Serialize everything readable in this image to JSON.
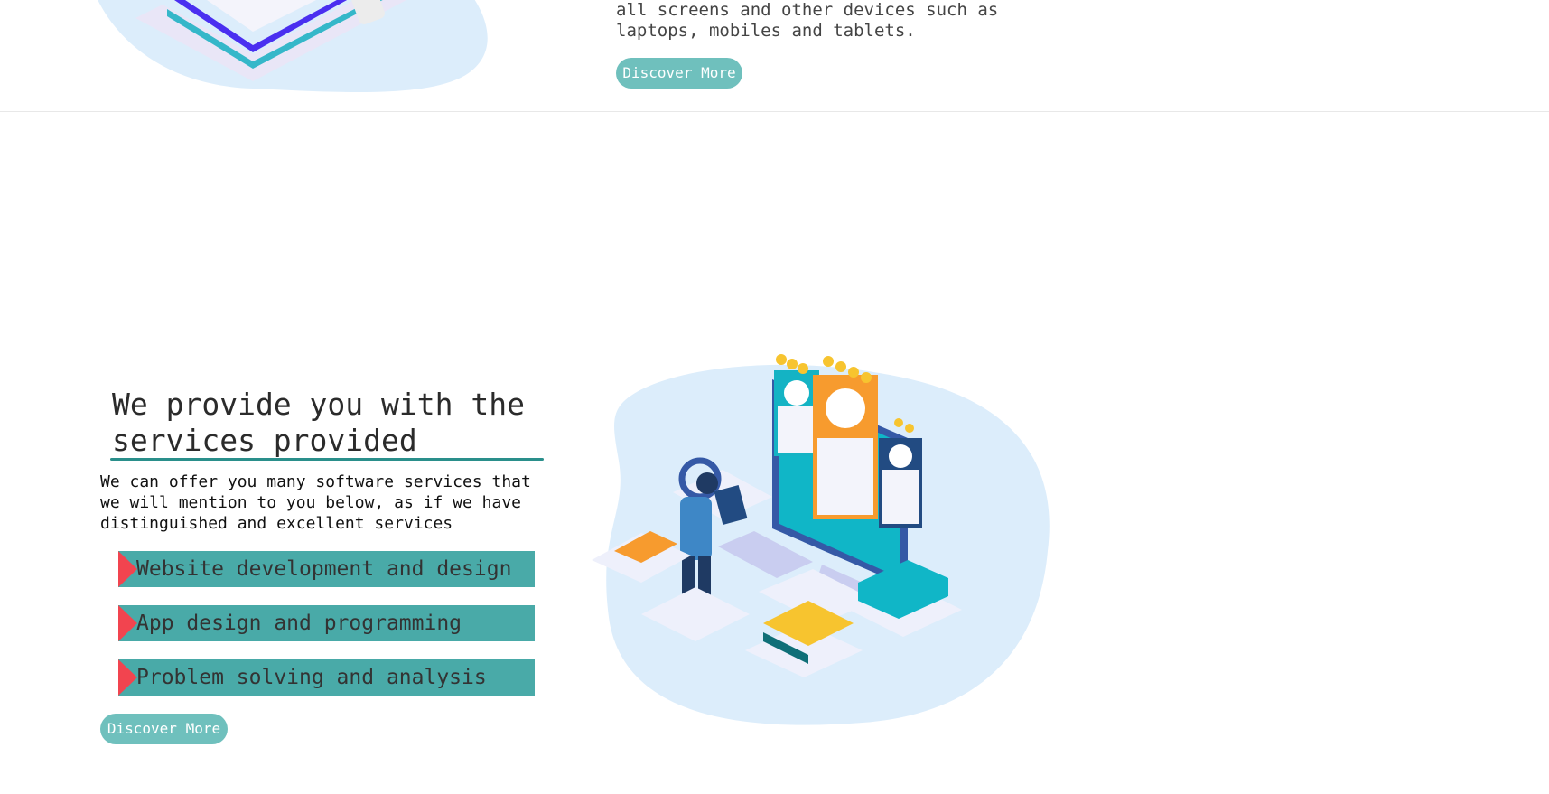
{
  "top_section": {
    "text": "all screens and other devices such as laptops, mobiles and tablets.",
    "button_label": "Discover More"
  },
  "services_section": {
    "title": "We provide you with the services provided",
    "description": "We can offer you many software services that we will mention to you below, as if we have distinguished and excellent services",
    "items": [
      {
        "label": "Website development and design"
      },
      {
        "label": "App design and programming"
      },
      {
        "label": "Problem solving and analysis"
      }
    ],
    "button_label": "Discover More"
  },
  "colors": {
    "accent_teal": "#49aaa8",
    "button_teal": "#6fc0bd",
    "marker_red": "#f2444f",
    "blob_blue": "#dcedfb"
  },
  "icons": [
    "isometric-stack-illustration",
    "profile-review-illustration"
  ]
}
